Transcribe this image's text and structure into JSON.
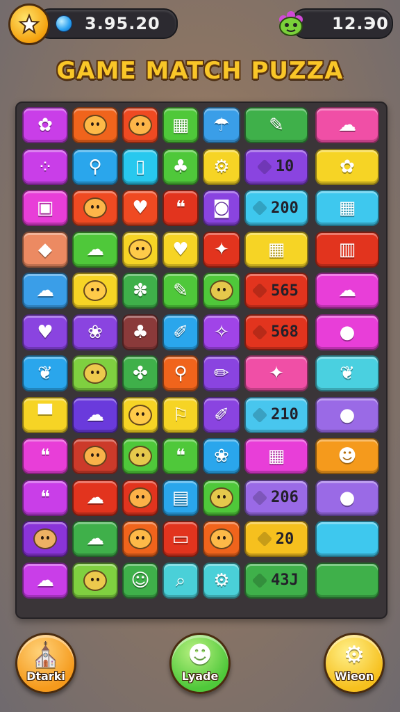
{
  "header": {
    "coins": "3.95.20",
    "score": "12.Э0",
    "coin_icon": "gem-icon",
    "star_icon": "star-icon",
    "monster_icon": "green-monster-icon"
  },
  "title": "GAME MATCH PUZZA",
  "board": {
    "rows": [
      [
        {
          "color": "#c93ee8",
          "icon": "blob",
          "label": ""
        },
        {
          "color": "#f0641c",
          "icon": "face",
          "label": ""
        },
        {
          "color": "#ef4a22",
          "icon": "face",
          "label": ""
        },
        {
          "color": "#4fc83a",
          "icon": "box",
          "label": ""
        },
        {
          "color": "#3a9ee8",
          "icon": "mushroom",
          "label": ""
        },
        {
          "color": "#3fb04a",
          "icon": "tool",
          "label": ""
        },
        {
          "color": "#f04fa6",
          "icon": "cloud",
          "label": ""
        }
      ],
      [
        {
          "color": "#c93ee8",
          "icon": "dots",
          "label": ""
        },
        {
          "color": "#2aa6ec",
          "icon": "mic",
          "label": ""
        },
        {
          "color": "#28c8ee",
          "icon": "phone",
          "label": ""
        },
        {
          "color": "#4fc83a",
          "icon": "pop",
          "label": ""
        },
        {
          "color": "#f6d425",
          "icon": "gear",
          "label": ""
        },
        {
          "color": "#8a44e0",
          "icon": "diamond",
          "label": "10"
        },
        {
          "color": "#f6d425",
          "icon": "blob",
          "label": ""
        }
      ],
      [
        {
          "color": "#e83ed8",
          "icon": "bucket",
          "label": ""
        },
        {
          "color": "#ef4a22",
          "icon": "face",
          "label": ""
        },
        {
          "color": "#ef4a22",
          "icon": "heart",
          "label": ""
        },
        {
          "color": "#e2341e",
          "icon": "chat",
          "label": ""
        },
        {
          "color": "#8a44e0",
          "icon": "camera",
          "label": ""
        },
        {
          "color": "#3ec8ee",
          "icon": "diamond",
          "label": "200"
        },
        {
          "color": "#3ec8ee",
          "icon": "calendar",
          "label": ""
        }
      ],
      [
        {
          "color": "#ec8a62",
          "icon": "fish",
          "label": ""
        },
        {
          "color": "#4fc83a",
          "icon": "cloud",
          "label": ""
        },
        {
          "color": "#f6d425",
          "icon": "face",
          "label": ""
        },
        {
          "color": "#f6d425",
          "icon": "heart",
          "label": ""
        },
        {
          "color": "#e2341e",
          "icon": "bird",
          "label": ""
        },
        {
          "color": "#f6d425",
          "icon": "calendar",
          "label": ""
        },
        {
          "color": "#e2341e",
          "icon": "building",
          "label": ""
        }
      ],
      [
        {
          "color": "#3a9ee8",
          "icon": "cloud",
          "label": ""
        },
        {
          "color": "#f6d425",
          "icon": "face",
          "label": ""
        },
        {
          "color": "#3fb04a",
          "icon": "flower",
          "label": ""
        },
        {
          "color": "#4fc83a",
          "icon": "tool",
          "label": ""
        },
        {
          "color": "#4fc83a",
          "icon": "face",
          "label": ""
        },
        {
          "color": "#e2341e",
          "icon": "diamond",
          "label": "565"
        },
        {
          "color": "#e83ed8",
          "icon": "cloud",
          "label": ""
        }
      ],
      [
        {
          "color": "#8a44e0",
          "icon": "heart",
          "label": ""
        },
        {
          "color": "#8a44e0",
          "icon": "shell",
          "label": ""
        },
        {
          "color": "#8a3a3a",
          "icon": "pop",
          "label": ""
        },
        {
          "color": "#2aa6ec",
          "icon": "brush",
          "label": ""
        },
        {
          "color": "#a044e8",
          "icon": "wand",
          "label": ""
        },
        {
          "color": "#e2341e",
          "icon": "diamond",
          "label": "568"
        },
        {
          "color": "#e83ed8",
          "icon": "cookie",
          "label": ""
        }
      ],
      [
        {
          "color": "#2aa6ec",
          "icon": "leaf",
          "label": ""
        },
        {
          "color": "#7fd040",
          "icon": "face",
          "label": ""
        },
        {
          "color": "#3fb04a",
          "icon": "fan",
          "label": ""
        },
        {
          "color": "#f0641c",
          "icon": "spoon",
          "label": ""
        },
        {
          "color": "#8a44e0",
          "icon": "pencil",
          "label": ""
        },
        {
          "color": "#f04fa6",
          "icon": "bird",
          "label": ""
        },
        {
          "color": "#4ad0e0",
          "icon": "leaf",
          "label": ""
        }
      ],
      [
        {
          "color": "#f6d425",
          "icon": "cup",
          "label": ""
        },
        {
          "color": "#6a3adc",
          "icon": "cloud",
          "label": ""
        },
        {
          "color": "#f6d425",
          "icon": "face",
          "label": ""
        },
        {
          "color": "#f6d425",
          "icon": "pin",
          "label": ""
        },
        {
          "color": "#8a44e0",
          "icon": "brush",
          "label": ""
        },
        {
          "color": "#48c6ee",
          "icon": "diamond",
          "label": "210"
        },
        {
          "color": "#9a6ae6",
          "icon": "cookie",
          "label": ""
        }
      ],
      [
        {
          "color": "#e83ed8",
          "icon": "chat",
          "label": ""
        },
        {
          "color": "#cc3a2a",
          "icon": "face",
          "label": ""
        },
        {
          "color": "#4fc83a",
          "icon": "face",
          "label": ""
        },
        {
          "color": "#4fc83a",
          "icon": "chat",
          "label": ""
        },
        {
          "color": "#2aa6ec",
          "icon": "shell",
          "label": ""
        },
        {
          "color": "#e83ed8",
          "icon": "calendar",
          "label": ""
        },
        {
          "color": "#f59a1c",
          "icon": "bear",
          "label": ""
        }
      ],
      [
        {
          "color": "#c93ee8",
          "icon": "chat",
          "label": ""
        },
        {
          "color": "#e2341e",
          "icon": "cloud",
          "label": ""
        },
        {
          "color": "#e2341e",
          "icon": "face",
          "label": ""
        },
        {
          "color": "#2aa6ec",
          "icon": "truck",
          "label": ""
        },
        {
          "color": "#4fc83a",
          "icon": "face",
          "label": ""
        },
        {
          "color": "#9a6ae6",
          "icon": "diamond",
          "label": "206"
        },
        {
          "color": "#9a6ae6",
          "icon": "cookie",
          "label": ""
        }
      ],
      [
        {
          "color": "#8a34d8",
          "icon": "face",
          "label": ""
        },
        {
          "color": "#3fb04a",
          "icon": "cloud",
          "label": ""
        },
        {
          "color": "#f0641c",
          "icon": "face",
          "label": ""
        },
        {
          "color": "#e2341e",
          "icon": "tv",
          "label": ""
        },
        {
          "color": "#f0641c",
          "icon": "face",
          "label": ""
        },
        {
          "color": "#f6c01e",
          "icon": "diamond",
          "label": "20"
        },
        {
          "color": "#3ec8ee",
          "icon": "none",
          "label": ""
        }
      ],
      [
        {
          "color": "#c93ee8",
          "icon": "cloud",
          "label": ""
        },
        {
          "color": "#7fd040",
          "icon": "face",
          "label": ""
        },
        {
          "color": "#3fb04a",
          "icon": "person",
          "label": ""
        },
        {
          "color": "#4ad0d8",
          "icon": "search",
          "label": ""
        },
        {
          "color": "#4ad0d8",
          "icon": "gear",
          "label": ""
        },
        {
          "color": "#3fb04a",
          "icon": "diamond",
          "label": "4ЗЈ"
        },
        {
          "color": "#3fb04a",
          "icon": "none",
          "label": ""
        }
      ]
    ]
  },
  "bottom": {
    "left": {
      "label": "Dtarki",
      "icon": "building-icon",
      "color": "#f59a1c"
    },
    "center": {
      "label": "Lyade",
      "icon": "character-icon",
      "color": "#4fc83a"
    },
    "right": {
      "label": "Wieon",
      "icon": "gear-icon",
      "color": "#f6c01e"
    }
  }
}
